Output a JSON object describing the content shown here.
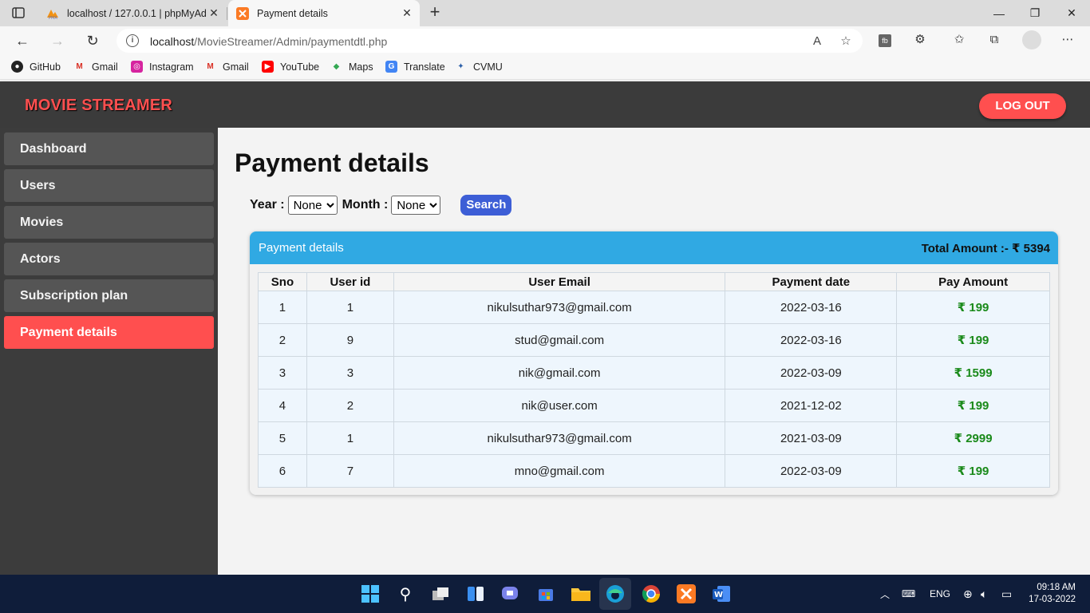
{
  "browser": {
    "tabs": [
      {
        "title": "localhost / 127.0.0.1 | phpMyAdmin"
      },
      {
        "title": "Payment details"
      }
    ],
    "url_host": "localhost",
    "url_path": "/MovieStreamer/Admin/paymentdtl.php",
    "bookmarks": [
      "GitHub",
      "Gmail",
      "Instagram",
      "Gmail",
      "YouTube",
      "Maps",
      "Translate",
      "CVMU"
    ]
  },
  "header": {
    "brand": "MOVIE STREAMER",
    "logout_label": "LOG OUT"
  },
  "sidebar": {
    "items": [
      {
        "label": "Dashboard"
      },
      {
        "label": "Users"
      },
      {
        "label": "Movies"
      },
      {
        "label": "Actors"
      },
      {
        "label": "Subscription plan"
      },
      {
        "label": "Payment details"
      }
    ],
    "active_index": 5
  },
  "main": {
    "title": "Payment details",
    "filters": {
      "year_label": "Year :",
      "year_value": "None",
      "month_label": "Month :",
      "month_value": "None",
      "search_label": "Search"
    },
    "card": {
      "title": "Payment details",
      "total": "Total Amount :- ₹ 5394"
    },
    "table": {
      "headers": [
        "Sno",
        "User id",
        "User Email",
        "Payment date",
        "Pay Amount"
      ],
      "rows": [
        [
          "1",
          "1",
          "nikulsuthar973@gmail.com",
          "2022-03-16",
          "₹ 199"
        ],
        [
          "2",
          "9",
          "stud@gmail.com",
          "2022-03-16",
          "₹ 199"
        ],
        [
          "3",
          "3",
          "nik@gmail.com",
          "2022-03-09",
          "₹ 1599"
        ],
        [
          "4",
          "2",
          "nik@user.com",
          "2021-12-02",
          "₹ 199"
        ],
        [
          "5",
          "1",
          "nikulsuthar973@gmail.com",
          "2021-03-09",
          "₹ 2999"
        ],
        [
          "6",
          "7",
          "mno@gmail.com",
          "2022-03-09",
          "₹ 199"
        ]
      ]
    }
  },
  "taskbar": {
    "lang": "ENG",
    "time": "09:18 AM",
    "date": "17-03-2022"
  },
  "colors": {
    "accent_red": "#ff4f4f",
    "header_bg": "#3b3b3b",
    "card_head": "#30a9e3",
    "amount_green": "#1a8a1a",
    "search_blue": "#3d5ed6"
  }
}
